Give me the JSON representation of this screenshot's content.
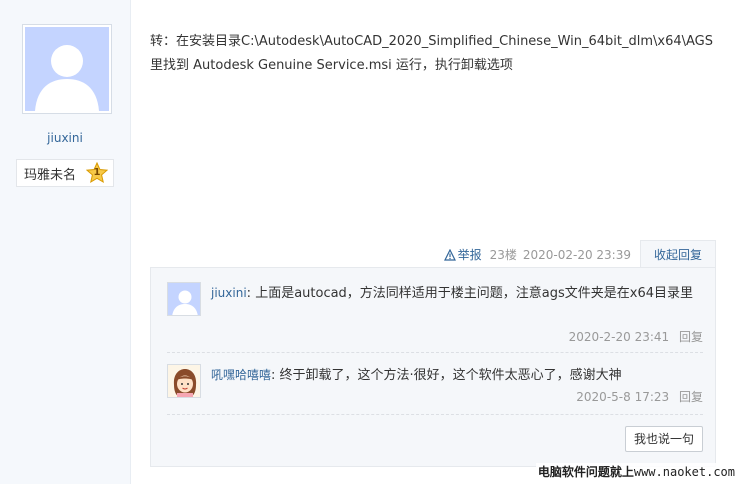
{
  "author": {
    "username": "jiuxini",
    "rank_title": "玛雅未名",
    "rank_level": "1"
  },
  "post": {
    "line1": "转：在安装目录C:\\Autodesk\\AutoCAD_2020_Simplified_Chinese_Win_64bit_dlm\\x64\\AGS",
    "line2": "里找到 Autodesk Genuine Service.msi 运行，执行卸载选项",
    "report_label": "举报",
    "floor": "23楼",
    "time": "2020-02-20 23:39",
    "collapse_label": "收起回复"
  },
  "replies": [
    {
      "name": "jiuxini",
      "separator": ":",
      "text": "上面是autocad，方法同样适用于楼主问题，注意ags文件夹是在x64目录里",
      "time": "2020-2-20 23:41",
      "action": "回复"
    },
    {
      "name": "吼嘿哈嘻嘻",
      "separator": ":",
      "text": "终于卸载了，这个方法·很好，这个软件太恶心了，感谢大神",
      "time": "2020-5-8 17:23",
      "action": "回复"
    }
  ],
  "say_button_label": "我也说一句",
  "watermark": {
    "text": "电脑软件问题就上",
    "url": "www.naoket.com"
  },
  "colors": {
    "link": "#336699",
    "avatar_bg": "#c4d4ff",
    "sidebar_bg": "#f5f8fc"
  }
}
